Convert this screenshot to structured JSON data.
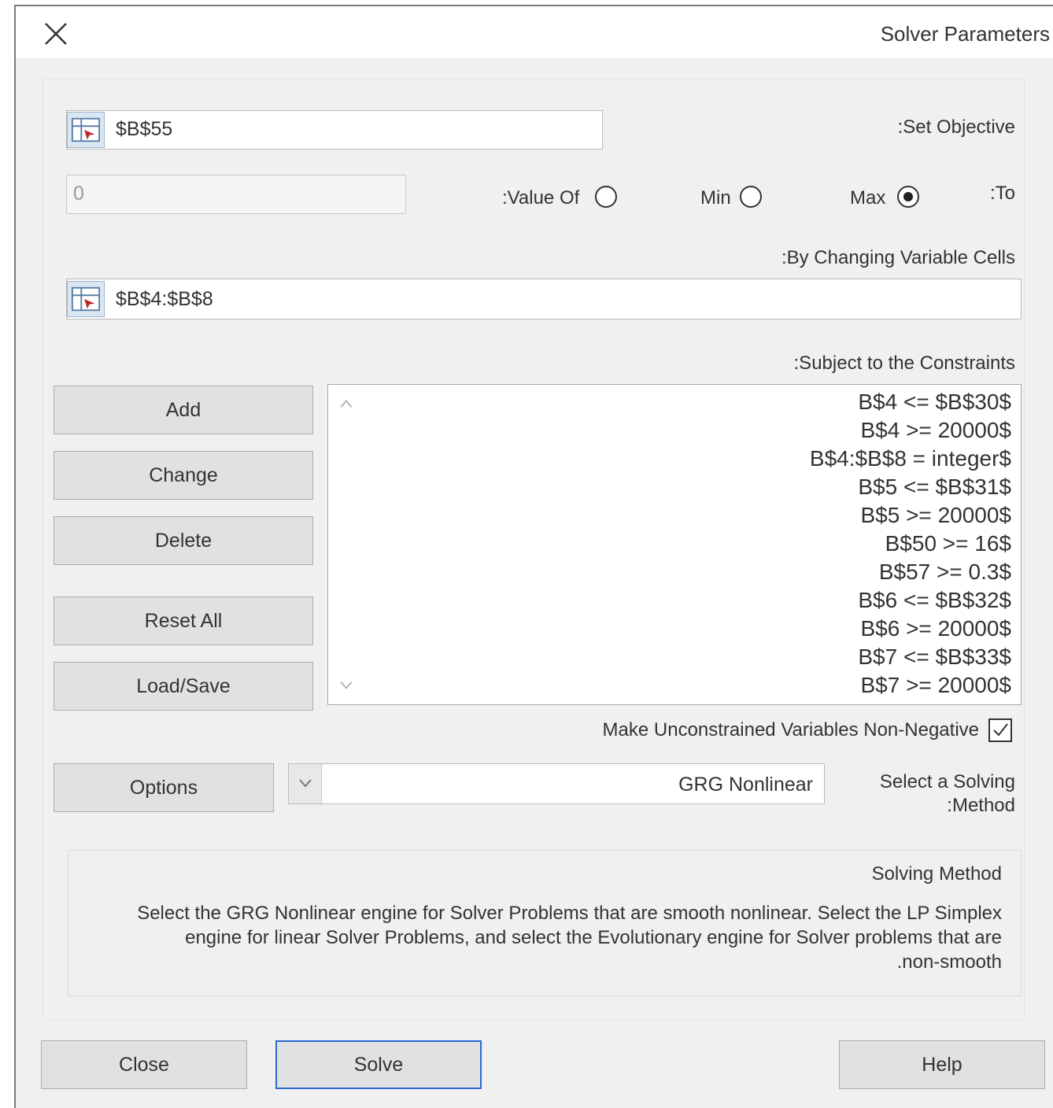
{
  "window": {
    "title": "Solver Parameters"
  },
  "objective": {
    "label": ":Set Objective",
    "value": "$B$55"
  },
  "to": {
    "label": ":To",
    "options": {
      "max": "Max",
      "min": "Min",
      "value_of": ":Value Of"
    },
    "selected": "max",
    "value_of_input": "0"
  },
  "changing": {
    "label": ":By Changing Variable Cells",
    "value": "$B$4:$B$8"
  },
  "constraints": {
    "label": ":Subject to the Constraints",
    "items": [
      "B$4 <= $B$30$",
      "B$4 >= 20000$",
      "B$4:$B$8 = integer$",
      "B$5 <= $B$31$",
      "B$5 >= 20000$",
      "B$50 >= 16$",
      "B$57 >= 0.3$",
      "B$6 <= $B$32$",
      "B$6 >= 20000$",
      "B$7 <= $B$33$",
      "B$7 >= 20000$"
    ]
  },
  "buttons": {
    "add": "Add",
    "change": "Change",
    "delete": "Delete",
    "reset_all": "Reset All",
    "load_save": "Load/Save",
    "options": "Options",
    "close": "Close",
    "solve": "Solve",
    "help": "Help"
  },
  "nonneg": {
    "label": "Make Unconstrained Variables Non-Negative",
    "checked": true
  },
  "method": {
    "label_line1": "Select a Solving",
    "label_line2": ":Method",
    "selected": "GRG Nonlinear"
  },
  "method_info": {
    "title": "Solving Method",
    "line1": "Select the GRG Nonlinear engine for Solver Problems that are smooth nonlinear. Select the LP Simplex",
    "line2": "engine for linear Solver Problems, and select the Evolutionary engine for Solver problems that are",
    "line3": ".non-smooth"
  }
}
